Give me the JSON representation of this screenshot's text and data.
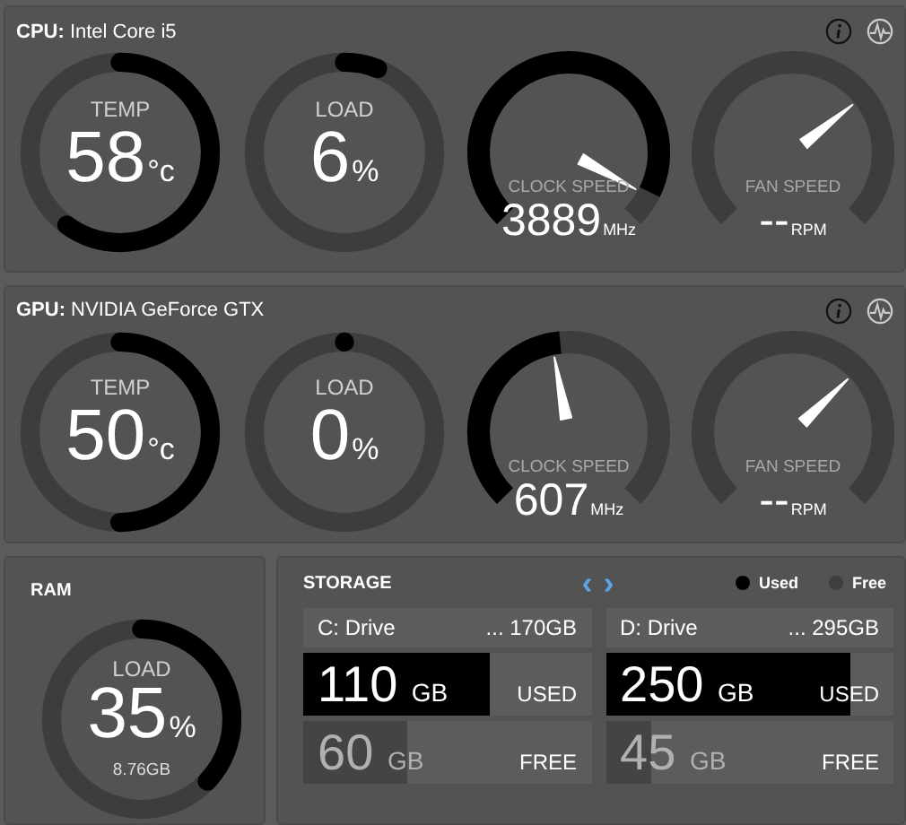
{
  "panels": [
    {
      "label": "CPU:",
      "name": "Intel Core i5",
      "gauges": [
        {
          "kind": "ring",
          "label": "TEMP",
          "value": "58",
          "unit": "°c",
          "level": 0.6
        },
        {
          "kind": "ring",
          "label": "LOAD",
          "value": "6",
          "unit": "%",
          "level": 0.06
        },
        {
          "kind": "dial",
          "label": "CLOCK SPEED",
          "value": "3889",
          "unit": "MHz"
        },
        {
          "kind": "dial",
          "label": "FAN SPEED",
          "value": "--",
          "unit": "RPM"
        }
      ]
    },
    {
      "label": "GPU:",
      "name": "NVIDIA GeForce GTX",
      "gauges": [
        {
          "kind": "ring",
          "label": "TEMP",
          "value": "50",
          "unit": "°c",
          "level": 0.5
        },
        {
          "kind": "ring",
          "label": "LOAD",
          "value": "0",
          "unit": "%",
          "level": 0
        },
        {
          "kind": "dial",
          "label": "CLOCK SPEED",
          "value": "607",
          "unit": "MHz"
        },
        {
          "kind": "dial",
          "label": "FAN SPEED",
          "value": "--",
          "unit": "RPM"
        }
      ]
    }
  ],
  "ram": {
    "title": "RAM",
    "label": "LOAD",
    "value": "35",
    "unit": "%",
    "detail": "8.76GB",
    "level": 0.37
  },
  "storage": {
    "title": "STORAGE",
    "prev": "‹",
    "next": "›",
    "legend": [
      {
        "label": "Used",
        "color": "#000000"
      },
      {
        "label": "Free",
        "color": "#3e3e3e"
      }
    ],
    "drives": [
      {
        "name": "C: Drive",
        "capacity": "... 170GB",
        "used": {
          "value": "110",
          "unit": "GB",
          "label": "USED",
          "level": 0.65
        },
        "free": {
          "value": "60",
          "unit": "GB",
          "label": "FREE",
          "level": 0.36
        }
      },
      {
        "name": "D: Drive",
        "capacity": "... 295GB",
        "used": {
          "value": "250",
          "unit": "GB",
          "label": "USED",
          "level": 0.85
        },
        "free": {
          "value": "45",
          "unit": "GB",
          "label": "FREE",
          "level": 0.16
        }
      }
    ]
  }
}
